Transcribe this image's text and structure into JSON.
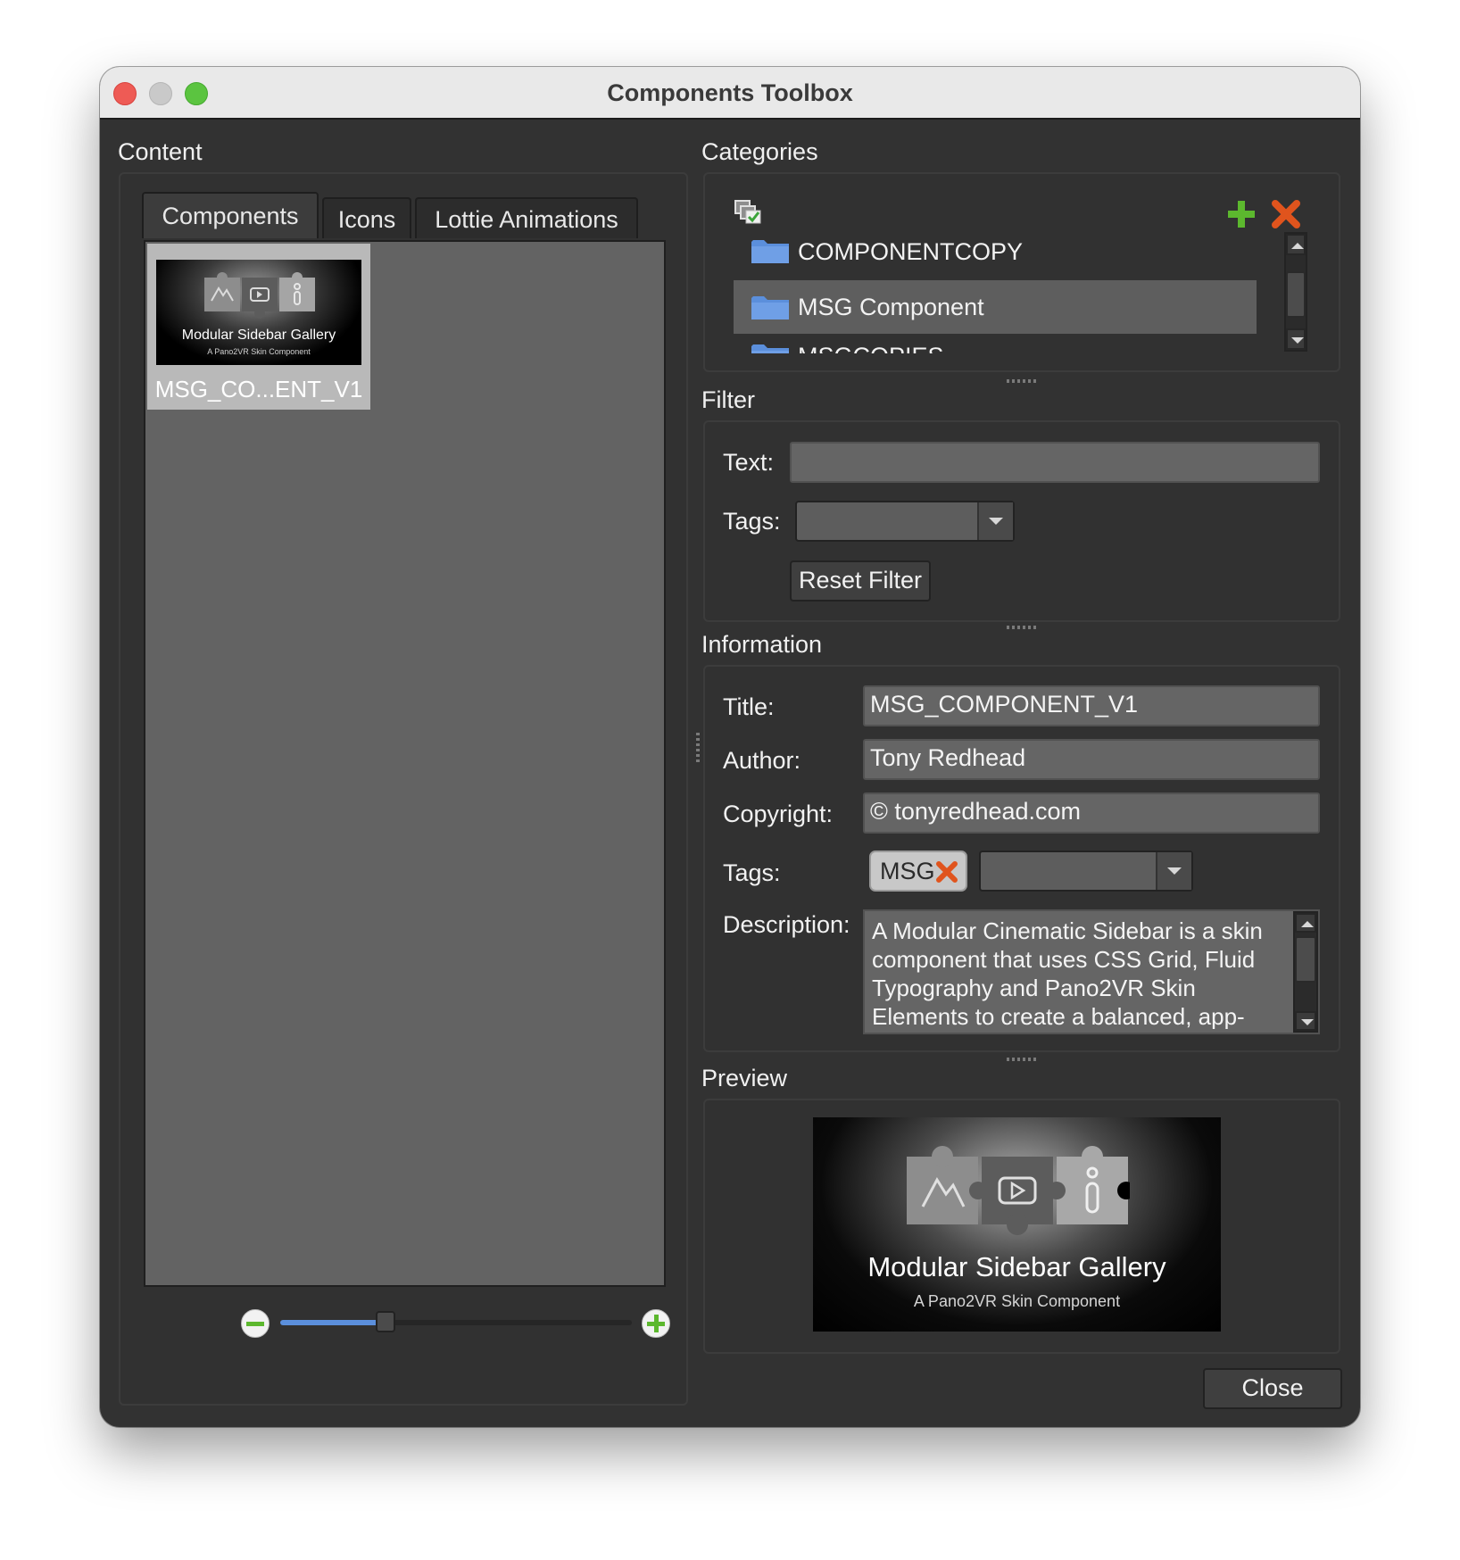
{
  "window": {
    "title": "Components Toolbox"
  },
  "content": {
    "label": "Content",
    "tabs": [
      {
        "label": "Components",
        "active": true
      },
      {
        "label": "Icons",
        "active": false
      },
      {
        "label": "Lottie Animations",
        "active": false
      }
    ],
    "items": [
      {
        "label": "MSG_CO...ENT_V1",
        "thumb_title": "Modular Sidebar Gallery",
        "thumb_subtitle": "A Pano2VR Skin Component"
      }
    ],
    "zoom_level": 0.3
  },
  "categories": {
    "label": "Categories",
    "items": [
      {
        "label": "COMPONENTCOPY",
        "selected": false
      },
      {
        "label": "MSG Component",
        "selected": true
      },
      {
        "label": "MSGCOPIES",
        "selected": false
      }
    ]
  },
  "filter": {
    "label": "Filter",
    "text_label": "Text:",
    "text_value": "",
    "tags_label": "Tags:",
    "tags_value": "",
    "reset_label": "Reset Filter"
  },
  "information": {
    "label": "Information",
    "title_label": "Title:",
    "title_value": "MSG_COMPONENT_V1",
    "author_label": "Author:",
    "author_value": "Tony Redhead",
    "copyright_label": "Copyright:",
    "copyright_value": "© tonyredhead.com",
    "tags_label": "Tags:",
    "tag_chip": "MSG",
    "description_label": "Description:",
    "description_value": "A Modular Cinematic Sidebar is a skin component that uses CSS Grid, Fluid Typography and Pano2VR Skin Elements to create a balanced, app-"
  },
  "preview": {
    "label": "Preview",
    "title": "Modular Sidebar Gallery",
    "subtitle": "A Pano2VR Skin Component"
  },
  "close_label": "Close",
  "colors": {
    "window_bg": "#323232",
    "selection": "#5e5e5e",
    "folder_blue": "#5b8fdc",
    "add_green": "#5cb82e",
    "remove_orange": "#e0541d",
    "slider_fill": "#5b8fdc"
  }
}
